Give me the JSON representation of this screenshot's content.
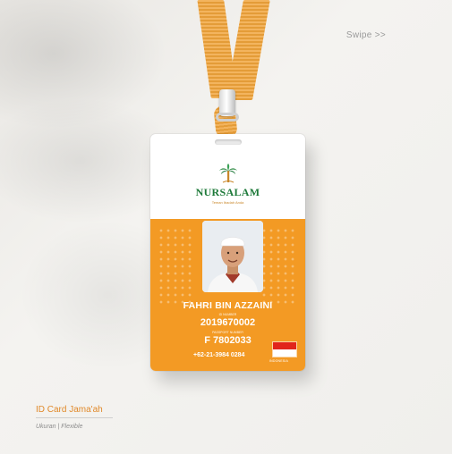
{
  "header": {
    "swipe_label": "Swipe >>"
  },
  "card": {
    "brand": "NURSALAM",
    "tagline": "Teman Ibadah Anda",
    "name": "FAHRI BIN AZZAINI",
    "id_label": "ID NUMBER",
    "id_number": "2019670002",
    "passport_label": "PASSPORT NUMBER",
    "passport_number": "F 7802033",
    "phone": "+62-21-3984 0284",
    "country": "INDONESIA"
  },
  "footer": {
    "title": "ID Card Jama'ah",
    "subtitle": "Ukuran | Flexible"
  },
  "colors": {
    "accent": "#f39a24",
    "brand_green": "#1e7a3a",
    "lanyard": "#f0a43b"
  }
}
